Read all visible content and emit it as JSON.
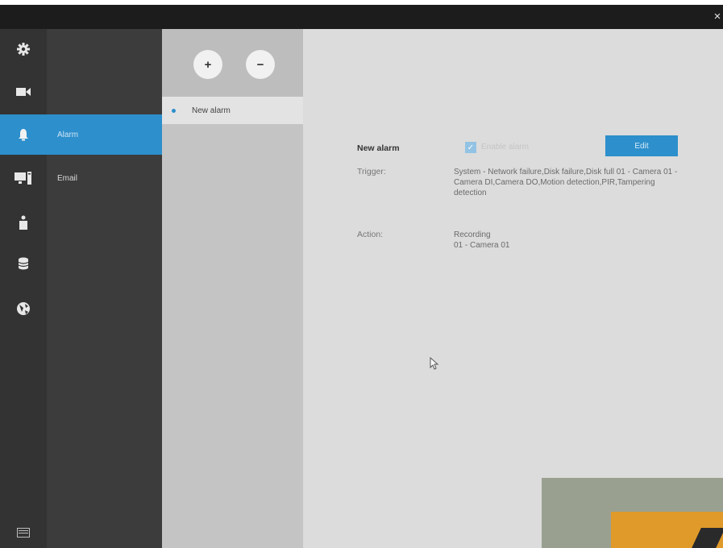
{
  "window": {
    "close_label": "×"
  },
  "icon_sidebar": {
    "items": [
      {
        "icon": "gear-icon",
        "active": false
      },
      {
        "icon": "camera-icon",
        "active": false
      },
      {
        "icon": "bell-icon",
        "active": true
      },
      {
        "icon": "monitor-icon",
        "active": false
      },
      {
        "icon": "user-icon",
        "active": false
      },
      {
        "icon": "database-icon",
        "active": false
      },
      {
        "icon": "globe-icon",
        "active": false
      },
      {
        "icon": "folder-icon",
        "active": false
      }
    ]
  },
  "submenu": {
    "items": [
      {
        "label": "Alarm",
        "active": true
      },
      {
        "label": "Email",
        "active": false
      }
    ]
  },
  "alarm_list": {
    "add_label": "+",
    "remove_label": "−",
    "items": [
      {
        "label": "New alarm",
        "selected": true
      }
    ]
  },
  "detail": {
    "name": "New alarm",
    "enable_label": "Enable alarm",
    "enabled": true,
    "edit_label": "Edit",
    "trigger_label": "Trigger:",
    "trigger_value": "System - Network failure,Disk failure,Disk full 01 - Camera 01 - Camera DI,Camera DO,Motion detection,PIR,Tampering detection",
    "action_label": "Action:",
    "action_value_line1": "Recording",
    "action_value_line2": "01 - Camera 01"
  },
  "colors": {
    "accent": "#2d8fcc",
    "topbar": "#1c1c1c",
    "icon_sidebar": "#333333",
    "submenu": "#3c3c3c",
    "list_panel": "#c4c4c4",
    "content": "#dcdcdc"
  }
}
